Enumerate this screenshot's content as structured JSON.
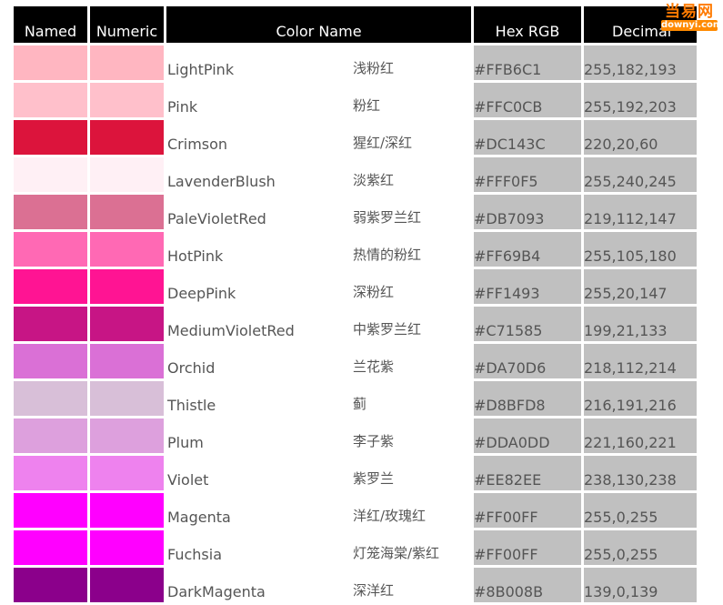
{
  "table": {
    "headers": {
      "named": "Named",
      "numeric": "Numeric",
      "color_name": "Color Name",
      "hex_rgb": "Hex RGB",
      "decimal": "Decimal"
    },
    "rows": [
      {
        "swatch": "#FFB6C1",
        "name": "LightPink",
        "chinese": "浅粉红",
        "hex": "#FFB6C1",
        "decimal": "255,182,193"
      },
      {
        "swatch": "#FFC0CB",
        "name": "Pink",
        "chinese": "粉红",
        "hex": "#FFC0CB",
        "decimal": "255,192,203"
      },
      {
        "swatch": "#DC143C",
        "name": "Crimson",
        "chinese": "猩红/深红",
        "hex": "#DC143C",
        "decimal": "220,20,60"
      },
      {
        "swatch": "#FFF0F5",
        "name": "LavenderBlush",
        "chinese": "淡紫红",
        "hex": "#FFF0F5",
        "decimal": "255,240,245"
      },
      {
        "swatch": "#DB7093",
        "name": "PaleVioletRed",
        "chinese": "弱紫罗兰红",
        "hex": "#DB7093",
        "decimal": "219,112,147"
      },
      {
        "swatch": "#FF69B4",
        "name": "HotPink",
        "chinese": "热情的粉红",
        "hex": "#FF69B4",
        "decimal": "255,105,180"
      },
      {
        "swatch": "#FF1493",
        "name": "DeepPink",
        "chinese": "深粉红",
        "hex": "#FF1493",
        "decimal": "255,20,147"
      },
      {
        "swatch": "#C71585",
        "name": "MediumVioletRed",
        "chinese": "中紫罗兰红",
        "hex": "#C71585",
        "decimal": "199,21,133"
      },
      {
        "swatch": "#DA70D6",
        "name": "Orchid",
        "chinese": "兰花紫",
        "hex": "#DA70D6",
        "decimal": "218,112,214"
      },
      {
        "swatch": "#D8BFD8",
        "name": "Thistle",
        "chinese": "蓟",
        "hex": "#D8BFD8",
        "decimal": "216,191,216"
      },
      {
        "swatch": "#DDA0DD",
        "name": "Plum",
        "chinese": "李子紫",
        "hex": "#DDA0DD",
        "decimal": "221,160,221"
      },
      {
        "swatch": "#EE82EE",
        "name": "Violet",
        "chinese": "紫罗兰",
        "hex": "#EE82EE",
        "decimal": "238,130,238"
      },
      {
        "swatch": "#FF00FF",
        "name": "Magenta",
        "chinese": "洋红/玫瑰红",
        "hex": "#FF00FF",
        "decimal": "255,0,255"
      },
      {
        "swatch": "#FF00FF",
        "name": "Fuchsia",
        "chinese": "灯笼海棠/紫红",
        "hex": "#FF00FF",
        "decimal": "255,0,255"
      },
      {
        "swatch": "#8B008B",
        "name": "DarkMagenta",
        "chinese": "深洋红",
        "hex": "#8B008B",
        "decimal": "139,0,139"
      }
    ]
  },
  "watermark": {
    "top": "当易网",
    "bottom": "downyi.com"
  },
  "colors": {
    "header_bg": "#000000",
    "header_text": "#FFFFFF",
    "value_cell_bg": "#C0C0C0",
    "body_text": "#555555"
  }
}
